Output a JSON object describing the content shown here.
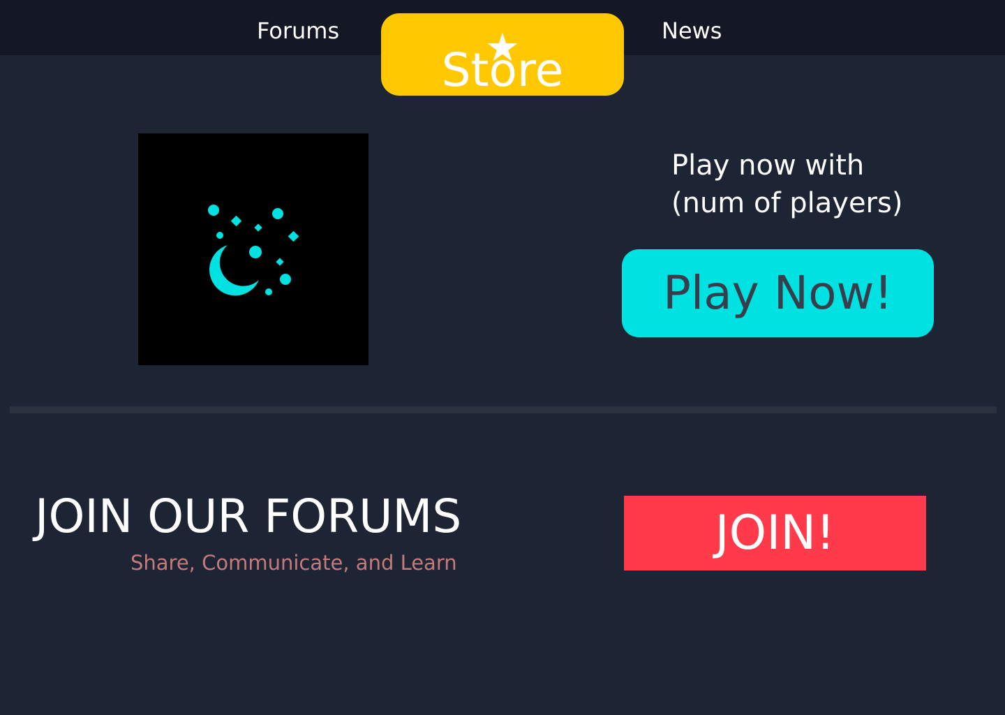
{
  "nav": {
    "forums_label": "Forums",
    "store_label": "Store",
    "news_label": "News",
    "store_icon": "★"
  },
  "hero": {
    "logo_icon": "moon-stars-icon",
    "caption": "Play now with\n(num of players)",
    "play_button_label": "Play Now!"
  },
  "forums": {
    "heading": "JOIN OUR FORUMS",
    "subheading": "Share, Communicate, and Learn",
    "join_button_label": "JOIN!"
  },
  "colors": {
    "background": "#1d2433",
    "topbar": "#141824",
    "store_accent": "#ffc800",
    "play_accent": "#00e1e1",
    "join_accent": "#ff3a4a",
    "logo_icon": "#00e1e1",
    "subheading": "#c57b7b"
  }
}
